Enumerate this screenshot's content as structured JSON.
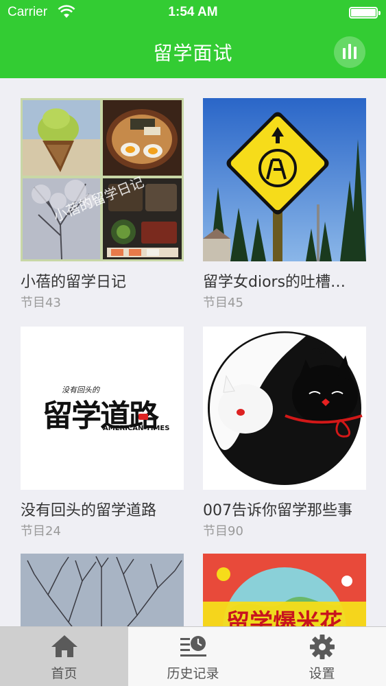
{
  "status_bar": {
    "carrier": "Carrier",
    "time": "1:54 AM"
  },
  "nav": {
    "title": "留学面试",
    "right_icon": "bar-chart-icon"
  },
  "cards": [
    {
      "title": "小蓓的留学日记",
      "subtitle": "节目43",
      "overlay_text": "小蓓的留学日记"
    },
    {
      "title": "留学女diors的吐槽…",
      "subtitle": "节目45"
    },
    {
      "title": "没有回头的留学道路",
      "subtitle": "节目24",
      "logo_top": "没有回头的",
      "logo_main": "留学道路",
      "logo_sub": "AMERICAN TIMES"
    },
    {
      "title": "007告诉你留学那些事",
      "subtitle": "节目90"
    },
    {
      "title": "",
      "subtitle": ""
    },
    {
      "title": "",
      "subtitle": "",
      "banner_text": "留学爆米花"
    }
  ],
  "tabs": [
    {
      "label": "首页",
      "icon": "home-icon",
      "active": true
    },
    {
      "label": "历史记录",
      "icon": "history-icon",
      "active": false
    },
    {
      "label": "设置",
      "icon": "gear-icon",
      "active": false
    }
  ],
  "colors": {
    "brand_green": "#33cc33",
    "tab_active_bg": "#cfcfcf"
  }
}
